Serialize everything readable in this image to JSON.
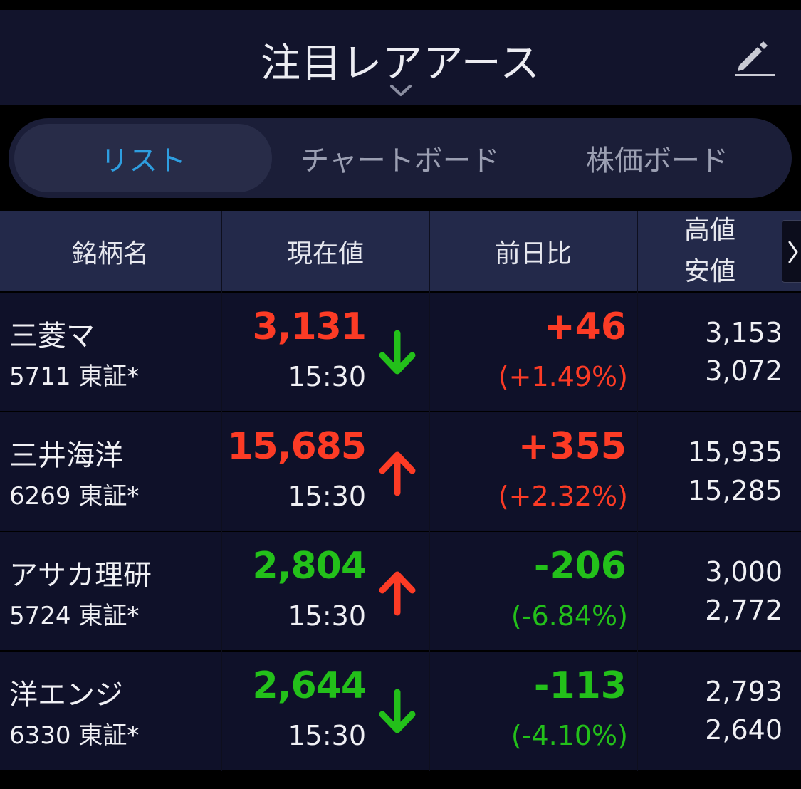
{
  "header": {
    "title": "注目レアアース"
  },
  "tabs": [
    {
      "label": "リスト",
      "active": true
    },
    {
      "label": "チャートボード",
      "active": false
    },
    {
      "label": "株価ボード",
      "active": false
    }
  ],
  "table": {
    "columns": [
      "銘柄名",
      "現在値",
      "前日比"
    ],
    "col_high": "高値",
    "col_low": "安値",
    "rows": [
      {
        "name": "三菱マ",
        "code": "5711 東証*",
        "price": "3,131",
        "price_dir": "up",
        "time": "15:30",
        "trend": "down",
        "change": "+46",
        "change_pct": "(+1.49%)",
        "change_dir": "up",
        "high": "3,153",
        "low": "3,072"
      },
      {
        "name": "三井海洋",
        "code": "6269 東証*",
        "price": "15,685",
        "price_dir": "up",
        "time": "15:30",
        "trend": "up",
        "change": "+355",
        "change_pct": "(+2.32%)",
        "change_dir": "up",
        "high": "15,935",
        "low": "15,285"
      },
      {
        "name": "アサカ理研",
        "code": "5724 東証*",
        "price": "2,804",
        "price_dir": "down",
        "time": "15:30",
        "trend": "up",
        "change": "-206",
        "change_pct": "(-6.84%)",
        "change_dir": "down",
        "high": "3,000",
        "low": "2,772"
      },
      {
        "name": "洋エンジ",
        "code": "6330 東証*",
        "price": "2,644",
        "price_dir": "down",
        "time": "15:30",
        "trend": "down",
        "change": "-113",
        "change_pct": "(-4.10%)",
        "change_dir": "down",
        "high": "2,793",
        "low": "2,640"
      }
    ]
  },
  "colors": {
    "up": "#fc3b25",
    "down": "#23c01a",
    "accent": "#2e9ee0",
    "header_bg": "#12142c",
    "row_bg": "#0f1129"
  },
  "icons": {
    "edit": "pencil-icon",
    "title_dropdown": "chevron-down-icon",
    "scroll": "chevron-right-icon",
    "trend_up": "arrow-up-icon",
    "trend_down": "arrow-down-icon"
  }
}
